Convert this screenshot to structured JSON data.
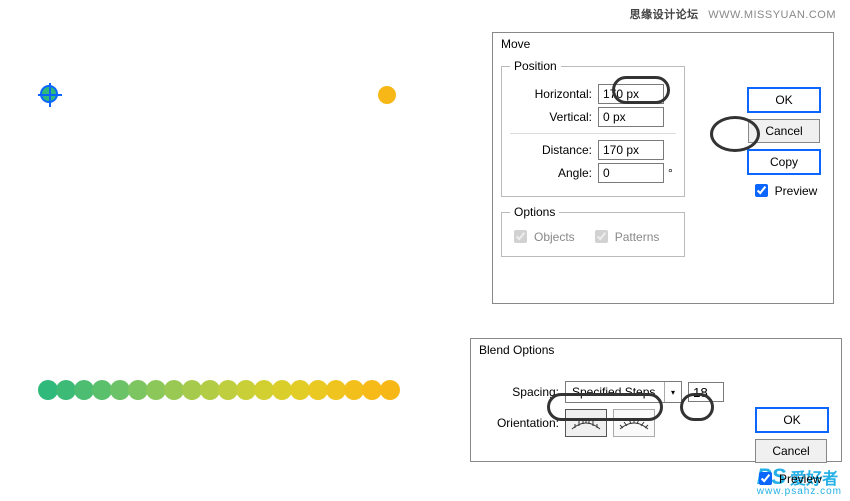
{
  "watermark": {
    "top_cn": "思缘设计论坛",
    "top_url": "WWW.MISSYUAN.COM",
    "bottom_brand": "PS",
    "bottom_cn": "爱好者",
    "bottom_url": "www.psahz.com"
  },
  "canvas": {
    "green_dot_color": "#2fb97a",
    "yellow_dot_color": "#f7b817",
    "blend_colors": [
      "#2fb97a",
      "#3cba76",
      "#4cbd71",
      "#5bc06c",
      "#6cc266",
      "#7cc560",
      "#8bc759",
      "#99c953",
      "#a6cb4c",
      "#b2cc45",
      "#bece3e",
      "#c8cf37",
      "#d2cf31",
      "#dace2b",
      "#e2cc26",
      "#e9c922",
      "#efc41e",
      "#f3bf1b",
      "#f6ba19",
      "#f7b817"
    ]
  },
  "move": {
    "title": "Move",
    "position_legend": "Position",
    "horizontal_label": "Horizontal:",
    "horizontal_value": "170 px",
    "vertical_label": "Vertical:",
    "vertical_value": "0 px",
    "distance_label": "Distance:",
    "distance_value": "170 px",
    "angle_label": "Angle:",
    "angle_value": "0",
    "angle_unit": "°",
    "options_legend": "Options",
    "objects_label": "Objects",
    "patterns_label": "Patterns",
    "ok": "OK",
    "cancel": "Cancel",
    "copy": "Copy",
    "preview": "Preview"
  },
  "blend": {
    "title": "Blend Options",
    "spacing_label": "Spacing:",
    "spacing_mode": "Specified Steps",
    "spacing_value": "18",
    "orientation_label": "Orientation:",
    "ok": "OK",
    "cancel": "Cancel",
    "preview": "Preview"
  }
}
